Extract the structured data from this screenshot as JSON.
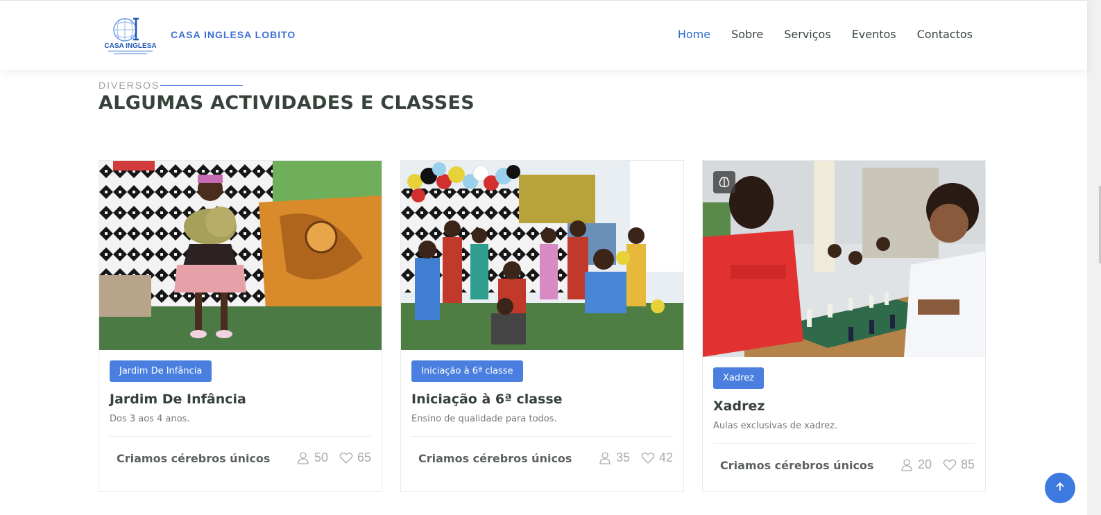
{
  "header": {
    "logo_text": "CASA INGLESA",
    "brand": "CASA INGLESA LOBITO",
    "nav": [
      "Home",
      "Sobre",
      "Serviços",
      "Eventos",
      "Contactos"
    ],
    "active": "Home"
  },
  "section": {
    "subtitle": "DIVERSOS",
    "title": "ALGUMAS ACTIVIDADES E CLASSES"
  },
  "cards": [
    {
      "badge": "Jardim De Infância",
      "title": "Jardim De Infância",
      "desc": "Dos 3 aos 4 anos.",
      "trainer": "Criamos cérebros únicos",
      "users": "50",
      "likes": "65"
    },
    {
      "badge": "Iniciação à 6ª classe",
      "title": "Iniciação à 6ª classe",
      "desc": "Ensino de qualidade para todos.",
      "trainer": "Criamos cérebros únicos",
      "users": "35",
      "likes": "42"
    },
    {
      "badge": "Xadrez",
      "title": "Xadrez",
      "desc": "Aulas exclusivas de xadrez.",
      "trainer": "Criamos cérebros únicos",
      "users": "20",
      "likes": "85"
    }
  ],
  "icons": {
    "users": "user-icon",
    "likes": "heart-icon",
    "back_to_top": "arrow-up-icon",
    "chess": "brain-icon"
  },
  "colors": {
    "accent": "#4a7fe0",
    "nav_active": "#2e6bd1",
    "text": "#37423b"
  }
}
